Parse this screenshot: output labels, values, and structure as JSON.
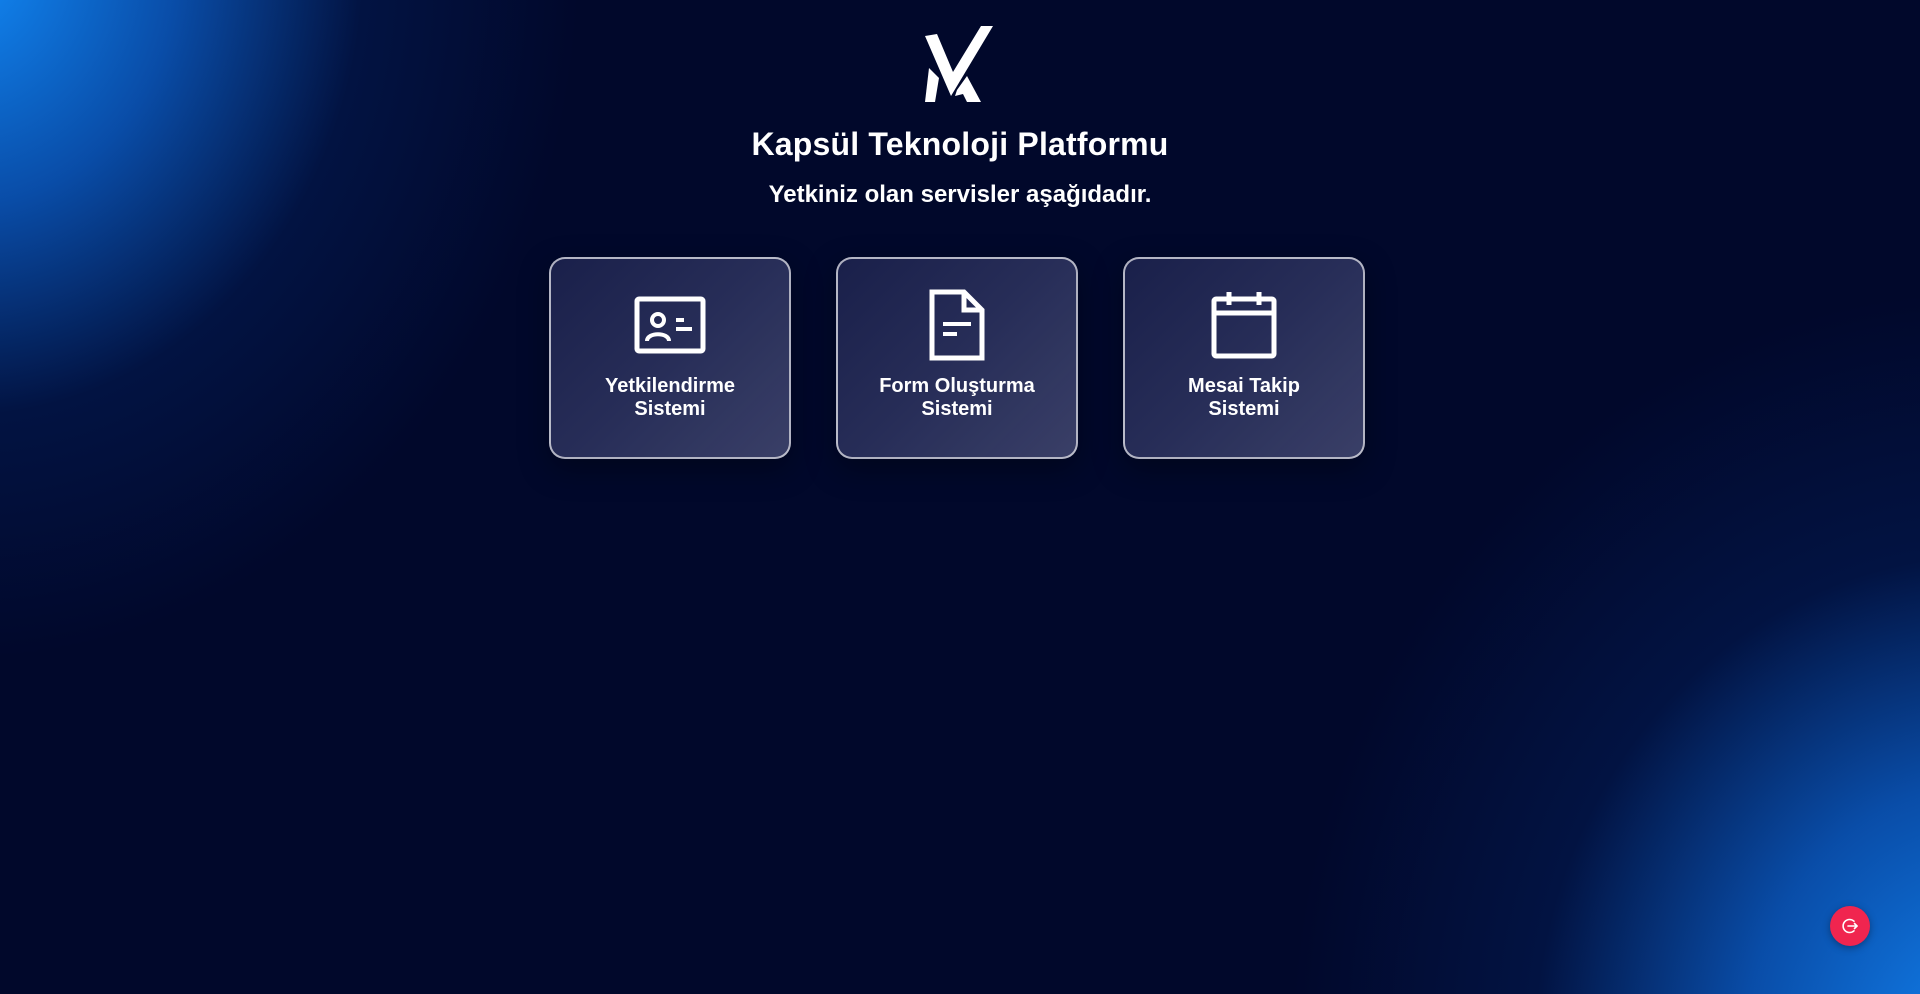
{
  "header": {
    "logo_icon": "kapsul-k-logo-icon",
    "title": "Kapsül Teknoloji Platformu",
    "subtitle": "Yetkiniz olan servisler aşağıdadır."
  },
  "services": [
    {
      "icon": "id-card-icon",
      "label_line1": "Yetkilendirme",
      "label_line2": "Sistemi"
    },
    {
      "icon": "document-icon",
      "label_line1": "Form Oluşturma",
      "label_line2": "Sistemi"
    },
    {
      "icon": "calendar-icon",
      "label_line1": "Mesai Takip",
      "label_line2": "Sistemi"
    }
  ],
  "fab": {
    "icon": "logout-icon",
    "color": "#f0254f"
  },
  "colors": {
    "background": "#01082b",
    "accent_glow": "#128cfa"
  }
}
